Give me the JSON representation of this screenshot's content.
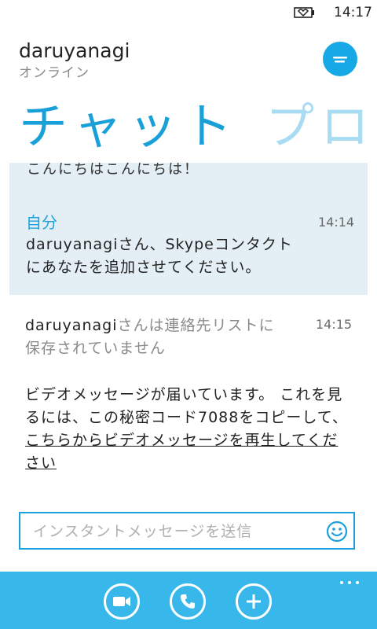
{
  "status_bar": {
    "time": "14:17"
  },
  "header": {
    "contact_name": "daruyanagi",
    "contact_status": "オンライン"
  },
  "pivot": {
    "active": "チャット",
    "next": "プロ"
  },
  "conversation": {
    "previous_text": "こんにちはこんにちは！",
    "self_message": {
      "sender": "自分",
      "time": "14:14",
      "text": "daruyanagiさん、Skypeコンタクトにあなたを追加させてください。"
    },
    "notice": {
      "name": "daruyanagi",
      "text": "さんは連絡先リストに保存されていません",
      "time": "14:15"
    },
    "video_message": {
      "text_before": "ビデオメッセージが届いています。 これを見るには、この秘密コード7088をコピーして、",
      "link_text": "こちらからビデオメッセージを再生してください"
    }
  },
  "input": {
    "placeholder": "インスタントメッセージを送信",
    "value": ""
  },
  "colors": {
    "accent": "#19a0d8",
    "appbar": "#38b7ea",
    "self_bubble": "#e3eff5",
    "pivot_inactive": "#a8dcf2"
  }
}
